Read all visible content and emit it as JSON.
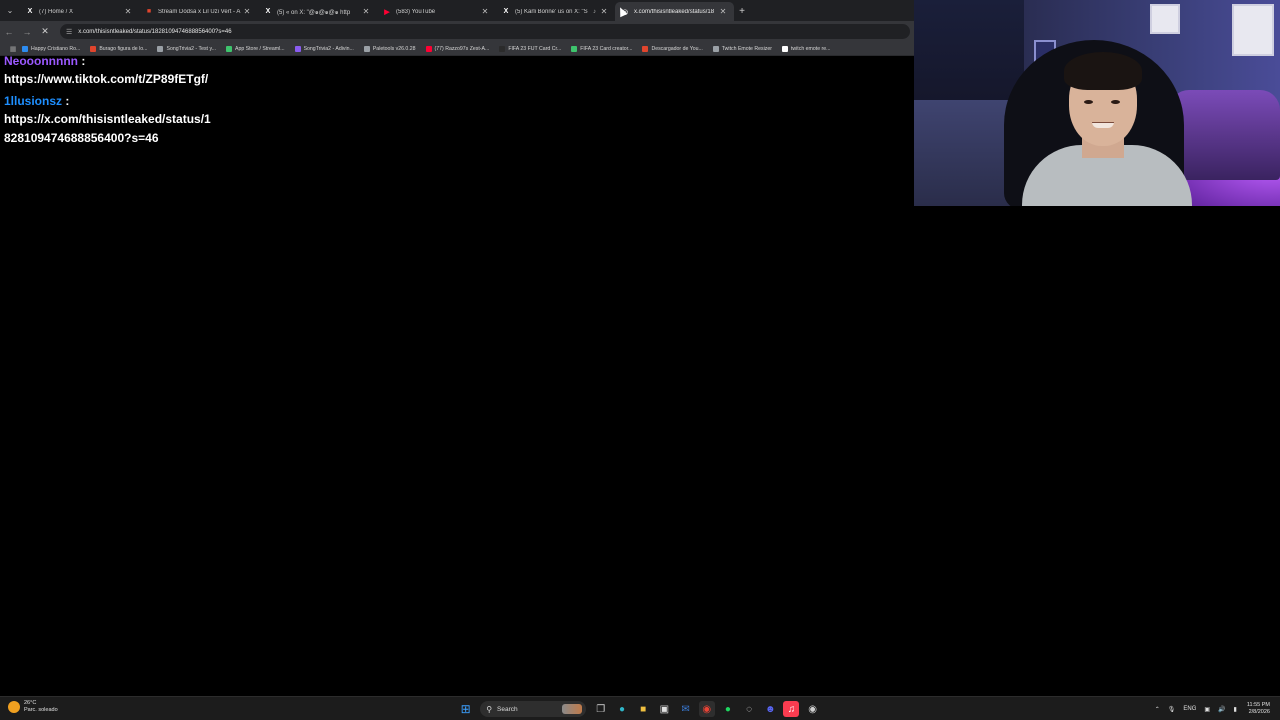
{
  "browser": {
    "tabs": [
      {
        "title": "(7) Home / X",
        "icon": "x-logo",
        "color": "#ffffff",
        "active": false
      },
      {
        "title": "Stream Dodsa x Lil Uzi Vert - A",
        "icon": "streamelements-logo",
        "color": "#e0452d",
        "active": false
      },
      {
        "title": "(5) « on X: \"@๑@๑@๑ http",
        "icon": "x-logo",
        "color": "#ffffff",
        "active": false
      },
      {
        "title": "(583) YouTube",
        "icon": "youtube-logo",
        "color": "#ff0033",
        "active": false
      },
      {
        "title": "(5) Karli Bonne' us on X: \"S",
        "icon": "x-logo",
        "color": "#ffffff",
        "active": false,
        "muted": true
      },
      {
        "title": "x.com/thisisntleaked/status/18",
        "icon": "globe-icon",
        "color": "#c8c8c8",
        "active": true
      }
    ],
    "newtab_label": "+",
    "url": "x.com/thisisntleaked/status/1828109474688856400?s=46",
    "bookmarks": [
      {
        "label": "Happy Cristiano Ro...",
        "color": "#2d8cf0"
      },
      {
        "label": "Burago figura de lo...",
        "color": "#e0452d"
      },
      {
        "label": "SongTrivia2 - Test y...",
        "color": "#9aa0a6"
      },
      {
        "label": "App Store / Streaml...",
        "color": "#3ec46d"
      },
      {
        "label": "SongTrivia2 - Adivin...",
        "color": "#8a5cf0"
      },
      {
        "label": "Paletools v26.0.28",
        "color": "#9aa0a6"
      },
      {
        "label": "(77) Razzo97s Zest-A...",
        "color": "#ff0033"
      },
      {
        "label": "FIFA 23 FUT Card Cr...",
        "color": "#2b2b2b"
      },
      {
        "label": "FIFA 23 Card creator...",
        "color": "#3ec46d"
      },
      {
        "label": "Descargador de You...",
        "color": "#e0452d"
      },
      {
        "label": "Twitch Emote Resizer",
        "color": "#9aa0a6"
      },
      {
        "label": "twitch emote re...",
        "color": "#ffffff"
      }
    ]
  },
  "chat": {
    "messages": [
      {
        "user": "Neooonnnnn",
        "user_color": "#9b59ff",
        "colon": " :",
        "text": "https://www.tiktok.com/t/ZP89fETgf/"
      },
      {
        "user": "1llusionsz",
        "user_color": "#1e8fff",
        "colon": " :",
        "text": "https://x.com/thisisntleaked/status/1828109474688856400?s=46"
      }
    ]
  },
  "taskbar": {
    "weather_temp": "26°C",
    "weather_desc": "Parc. soleado",
    "search_placeholder": "Search",
    "language": "ENG",
    "time": "11:55 PM",
    "date": "2/8/2026"
  }
}
